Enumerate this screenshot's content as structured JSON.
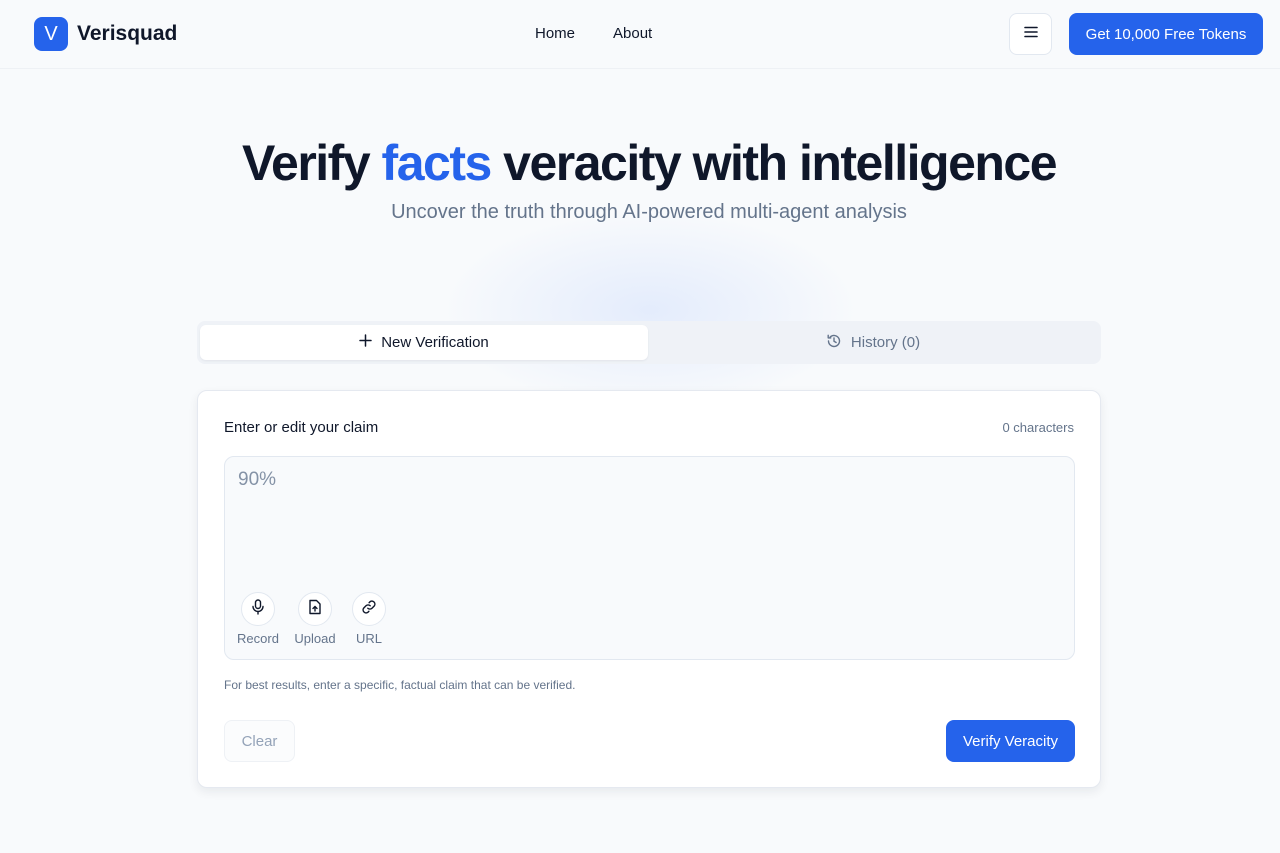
{
  "brand": {
    "logo_letter": "V",
    "name": "Verisquad",
    "accent_color": "#2563eb"
  },
  "nav": {
    "home": "Home",
    "about": "About",
    "menu_icon": "hamburger-menu-icon",
    "cta_label": "Get 10,000 Free Tokens"
  },
  "hero": {
    "title_before": "Verify ",
    "title_accent": "facts",
    "title_after": " veracity with intelligence",
    "subtitle": "Uncover the truth through AI-powered multi-agent analysis"
  },
  "tabs": [
    {
      "label": "New Verification",
      "icon": "plus-icon",
      "active": true
    },
    {
      "label": "History (0)",
      "icon": "history-icon",
      "active": false
    }
  ],
  "form": {
    "label": "Enter or edit your claim",
    "char_count": "0 characters",
    "placeholder": "90%",
    "value": "",
    "tools": [
      {
        "label": "Record",
        "icon": "microphone-icon"
      },
      {
        "label": "Upload",
        "icon": "file-upload-icon"
      },
      {
        "label": "URL",
        "icon": "link-icon"
      }
    ],
    "hint": "For best results, enter a specific, factual claim that can be verified.",
    "clear_label": "Clear",
    "submit_label": "Verify Veracity"
  }
}
